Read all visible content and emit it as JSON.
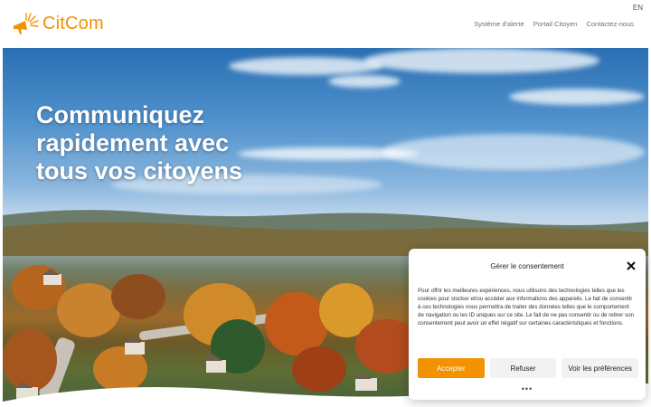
{
  "header": {
    "brand": "CitCom",
    "language": "EN",
    "nav": [
      {
        "label": "Système d'alerte"
      },
      {
        "label": "Portail Citoyen"
      },
      {
        "label": "Contactez-nous"
      }
    ]
  },
  "hero": {
    "title_lines": [
      "Communiquez",
      "rapidement avec",
      "tous vos citoyens"
    ]
  },
  "consent": {
    "title": "Gérer le consentement",
    "body": "Pour offrir les meilleures expériences, nous utilisons des technologies telles que les cookies pour stocker et/ou accéder aux informations des appareils. Le fait de consentir à ces technologies nous permettra de traiter des données telles que le comportement de navigation ou les ID uniques sur ce site. Le fait de ne pas consentir ou de retirer son consentement peut avoir un effet négatif sur certaines caractéristiques et fonctions.",
    "accept_label": "Accepter",
    "refuse_label": "Refuser",
    "prefs_label": "Voir les préférences",
    "more": "•••"
  },
  "colors": {
    "brand": "#f39200",
    "accept_button": "#f39200",
    "secondary_button": "#f2f2f2"
  },
  "icons": {
    "logo": "megaphone-sunburst-icon",
    "close": "close-icon"
  }
}
